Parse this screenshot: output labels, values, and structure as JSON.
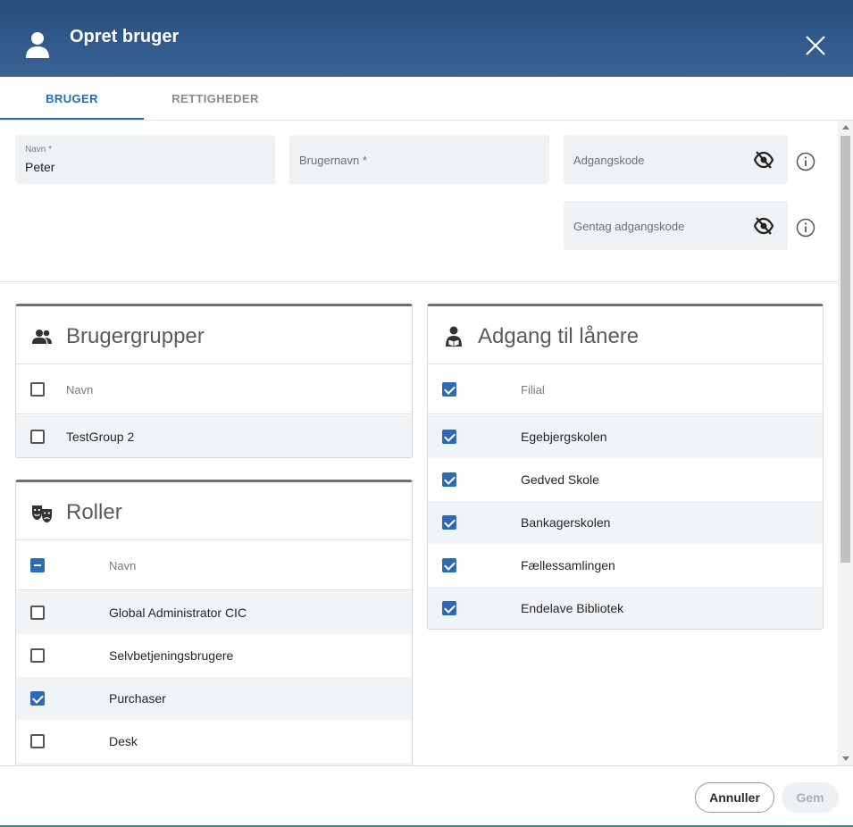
{
  "dialog": {
    "title": "Opret bruger",
    "header_color": "#2f5687"
  },
  "tabs": [
    {
      "label": "BRUGER",
      "active": true
    },
    {
      "label": "RETTIGHEDER",
      "active": false
    }
  ],
  "form": {
    "name": {
      "label": "Navn *",
      "value": "Peter"
    },
    "username": {
      "placeholder": "Brugernavn *"
    },
    "password": {
      "placeholder": "Adgangskode"
    },
    "repeat_password": {
      "placeholder": "Gentag adgangskode"
    }
  },
  "user_groups": {
    "title": "Brugergrupper",
    "icon": "people-icon",
    "column": "Navn",
    "rows": [
      {
        "label": "TestGroup 2",
        "checked": false
      }
    ]
  },
  "roles": {
    "title": "Roller",
    "icon": "theater-masks-icon",
    "column": "Navn",
    "rows": [
      {
        "label": "Global Administrator CIC",
        "checked": false
      },
      {
        "label": "Selvbetjeningsbrugere",
        "checked": false
      },
      {
        "label": "Purchaser",
        "checked": true
      },
      {
        "label": "Desk",
        "checked": false
      }
    ]
  },
  "borrower_access": {
    "title": "Adgang til lånere",
    "icon": "reader-icon",
    "column": "Filial",
    "rows": [
      {
        "label": "Egebjergskolen",
        "checked": true
      },
      {
        "label": "Gedved Skole",
        "checked": true
      },
      {
        "label": "Bankagerskolen",
        "checked": true
      },
      {
        "label": "Fællessamlingen",
        "checked": true
      },
      {
        "label": "Endelave Bibliotek",
        "checked": true
      }
    ]
  },
  "footer": {
    "cancel_label": "Annuller",
    "save_label": "Gem"
  },
  "colors": {
    "accent": "#2a6bb3",
    "field_bg": "#eef2f5"
  }
}
